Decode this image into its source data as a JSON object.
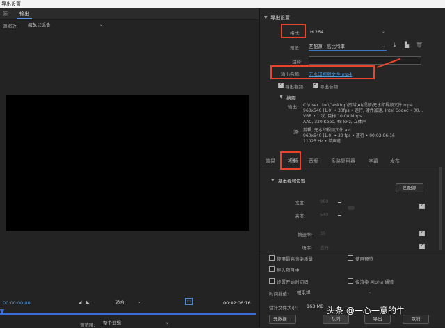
{
  "window": {
    "title": "导出设置"
  },
  "tabs": [
    {
      "label": "源"
    },
    {
      "label": "输出"
    }
  ],
  "source_scale": {
    "label": "源缩放:",
    "value": "缩放以适合"
  },
  "timeline": {
    "start": "00:00:00:00",
    "fit": "适合",
    "end": "00:02:06:16",
    "range_label": "源范围:",
    "range_value": "整个剪辑"
  },
  "export_settings": {
    "header": "导出设置",
    "format_label": "格式:",
    "format_value": "H.264",
    "preset_label": "预设:",
    "preset_value": "匹配源 - 高比特率",
    "comment_label": "注释:",
    "output_label": "输出名称:",
    "output_value": "无水印视频文件.mp4",
    "export_video": "导出视频",
    "export_audio": "导出音频"
  },
  "summary": {
    "title": "摘要",
    "output_label": "输出:",
    "output_lines": [
      "C:\\User...tor\\Desktop\\资料\\AI\\视频\\无水印视频文件.mp4",
      "960x540 (1.0) • 30fps • 逐行, 硬件加速, Intel Codec • 00...",
      "VBR • 1 次, 目标 10.00 Mbps",
      "AAC, 320 Kbps, 48  kHz, 立体声"
    ],
    "source_label": "源:",
    "source_lines": [
      "剪辑, 无水印视频文件.avi",
      "960x540 (1.0) • 30 fps • 逐行 • 00:02:06:16",
      "11025 Hz • 单声道"
    ]
  },
  "panel_tabs": [
    {
      "label": "效果"
    },
    {
      "label": "视频"
    },
    {
      "label": "音频"
    },
    {
      "label": "多路复用器"
    },
    {
      "label": "字幕"
    },
    {
      "label": "发布"
    }
  ],
  "video_settings": {
    "section": "基本视频设置",
    "match_source": "匹配源",
    "width_label": "宽度:",
    "width_value": "960",
    "height_label": "高度:",
    "height_value": "540",
    "frame_rate_label": "帧速率:",
    "frame_rate_value": "30",
    "field_order_label": "场序:",
    "field_order_value": "逐行"
  },
  "options": {
    "max_render": "使用最高渲染质量",
    "use_preview": "使用预览",
    "import_project": "导入项目中",
    "start_timecode": "设置开始时间码",
    "alpha_only": "仅渲染 Alpha 通道",
    "interpolation_label": "时间插值:",
    "interpolation_value": "帧采样",
    "filesize_label": "估计文件大小:",
    "filesize_value": "163 MB"
  },
  "buttons": {
    "metadata": "元数据...",
    "queue": "队列",
    "export": "导出",
    "cancel": "取消"
  },
  "watermark": "头条 @一心一意的牛",
  "colors": {
    "accent": "#3a6ed4",
    "annotation": "#e8452c",
    "link": "#4e9bdb"
  }
}
